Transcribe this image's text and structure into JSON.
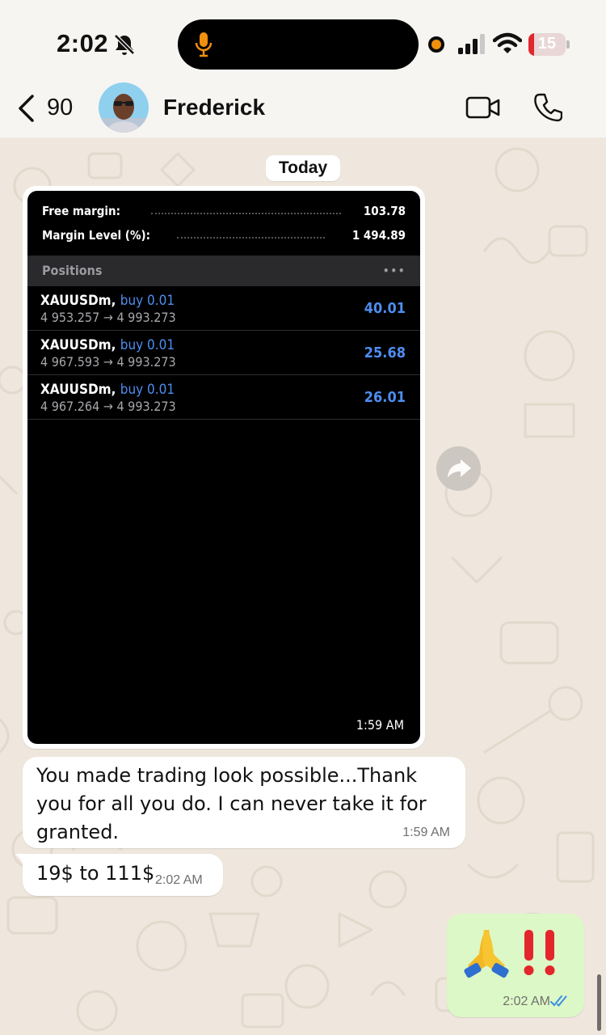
{
  "status_bar": {
    "time": "2:02",
    "battery": "15",
    "battery_level": 0.15
  },
  "header": {
    "back_count": "90",
    "contact_name": "Frederick"
  },
  "chat": {
    "date_chip": "Today",
    "image_message": {
      "free_margin_label": "Free margin:",
      "free_margin_value": "103.78",
      "margin_level_label": "Margin Level (%):",
      "margin_level_value": "1 494.89",
      "positions_title": "Positions",
      "more_label": "•••",
      "positions": [
        {
          "symbol": "XAUUSDm,",
          "side": "buy 0.01",
          "prices": "4 953.257 → 4 993.273",
          "profit": "40.01"
        },
        {
          "symbol": "XAUUSDm,",
          "side": "buy 0.01",
          "prices": "4 967.593 → 4 993.273",
          "profit": "25.68"
        },
        {
          "symbol": "XAUUSDm,",
          "side": "buy 0.01",
          "prices": "4 967.264 → 4 993.273",
          "profit": "26.01"
        }
      ],
      "time": "1:59 AM"
    },
    "messages": [
      {
        "text": "You made trading look possible...Thank you for all you do. I can never take it for granted.",
        "time": "1:59 AM",
        "direction": "incoming"
      },
      {
        "text": "19$ to 111$",
        "time": "2:02 AM",
        "direction": "incoming"
      },
      {
        "text": "🙏‼️",
        "time": "2:02 AM",
        "direction": "outgoing",
        "read": true
      }
    ]
  },
  "colors": {
    "accent_blue": "#4d8ef0",
    "outgoing_bubble": "#dcf8c6",
    "wallpaper": "#efe7dd",
    "battery_red": "#e0282e"
  }
}
